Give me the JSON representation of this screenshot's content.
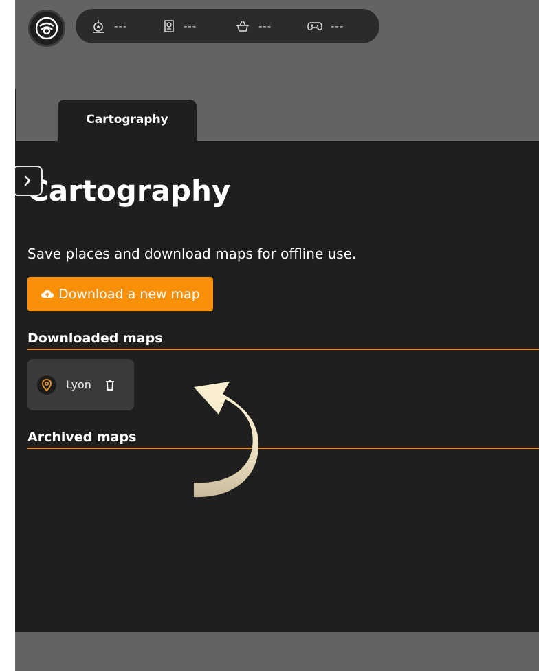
{
  "tab": {
    "label": "Cartography"
  },
  "status": [
    {
      "icon": "compass-icon",
      "value": "---"
    },
    {
      "icon": "location-card-icon",
      "value": "---"
    },
    {
      "icon": "basket-icon",
      "value": "---"
    },
    {
      "icon": "gamepad-icon",
      "value": "---"
    }
  ],
  "page": {
    "title": "Cartography",
    "subtitle": "Save places and download maps for offline use.",
    "download_label": "Download a new map"
  },
  "sections": {
    "downloaded": "Downloaded maps",
    "archived": "Archived maps"
  },
  "downloaded_maps": [
    {
      "name": "Lyon"
    }
  ],
  "colors": {
    "accent": "#fa8f08",
    "rule": "#f08a1a",
    "panel": "#1f1f1f",
    "card": "#3b3b3b",
    "frame": "#636363"
  }
}
